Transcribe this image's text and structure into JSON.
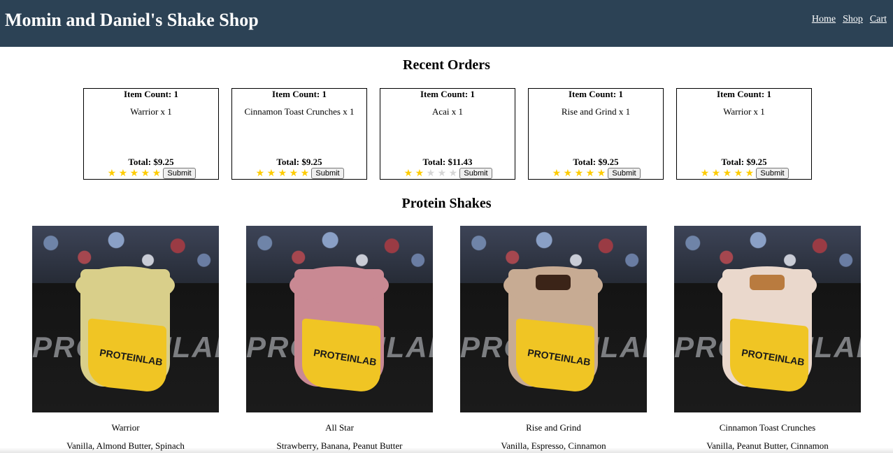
{
  "header": {
    "title": "Momin and Daniel's Shake Shop",
    "nav": [
      {
        "label": "Home"
      },
      {
        "label": "Shop"
      },
      {
        "label": "Cart"
      }
    ]
  },
  "recent_orders": {
    "title": "Recent Orders",
    "submit_label": "Submit",
    "orders": [
      {
        "count_label": "Item Count: 1",
        "item": "Warrior x 1",
        "total": "Total: $9.25",
        "rating": 5
      },
      {
        "count_label": "Item Count: 1",
        "item": "Cinnamon Toast Crunches x 1",
        "total": "Total: $9.25",
        "rating": 5
      },
      {
        "count_label": "Item Count: 1",
        "item": "Acai x 1",
        "total": "Total: $11.43",
        "rating": 2
      },
      {
        "count_label": "Item Count: 1",
        "item": "Rise and Grind x 1",
        "total": "Total: $9.25",
        "rating": 5
      },
      {
        "count_label": "Item Count: 1",
        "item": "Warrior x 1",
        "total": "Total: $9.25",
        "rating": 5
      }
    ],
    "star_colors": {
      "filled": "#ffcc00",
      "empty": "#d6d6d6"
    }
  },
  "protein_shakes": {
    "title": "Protein Shakes",
    "photo_wall_text": "PROTEINLAB",
    "cup_label": "PROTEINLAB",
    "items": [
      {
        "name": "Warrior",
        "description": "Vanilla, Almond Butter, Spinach"
      },
      {
        "name": "All Star",
        "description": "Strawberry, Banana, Peanut Butter"
      },
      {
        "name": "Rise and Grind",
        "description": "Vanilla, Espresso, Cinnamon"
      },
      {
        "name": "Cinnamon Toast Crunches",
        "description": "Vanilla, Peanut Butter, Cinnamon"
      }
    ]
  },
  "colors": {
    "header_bg": "#2c4255",
    "header_text": "#ffffff"
  }
}
